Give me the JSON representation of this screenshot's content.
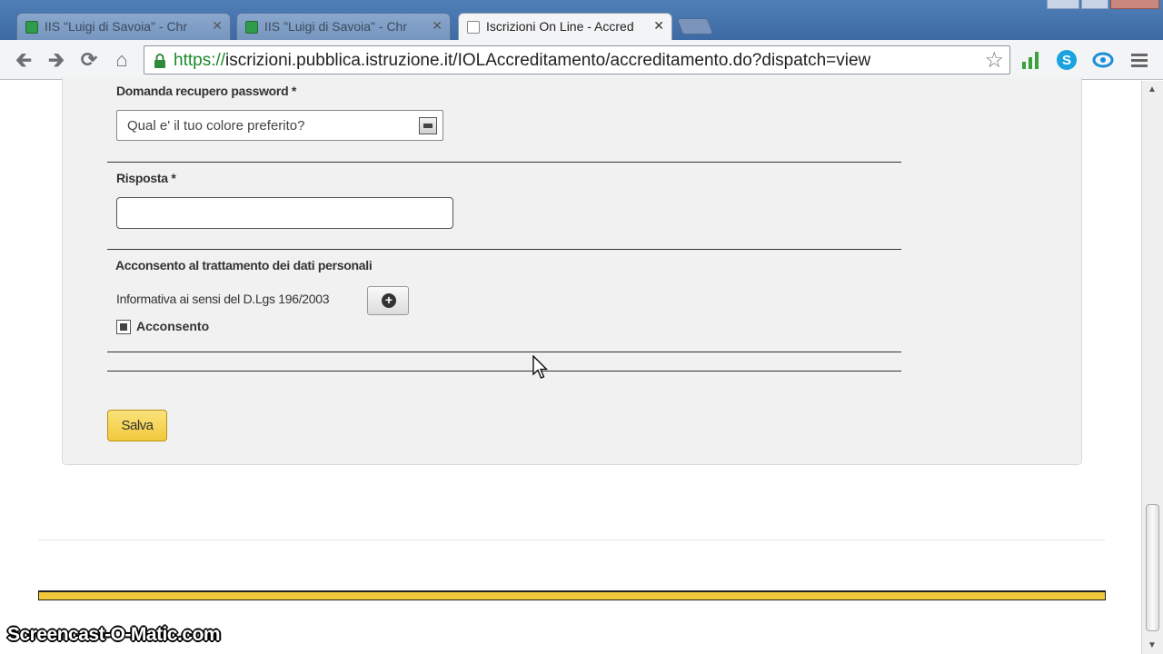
{
  "browser": {
    "tabs": [
      {
        "title": "IIS \"Luigi di Savoia\" - Chr",
        "active": false
      },
      {
        "title": "IIS \"Luigi di Savoia\" - Chr",
        "active": false
      },
      {
        "title": "Iscrizioni On Line - Accred",
        "active": true
      }
    ],
    "close_glyph": "✕",
    "url_scheme": "https://",
    "url_rest": "iscrizioni.pubblica.istruzione.it/IOLAccreditamento/accreditamento.do?dispatch=view",
    "icons": [
      "back-icon",
      "forward-icon",
      "reload-icon",
      "home-icon",
      "lock-icon",
      "star-icon",
      "signal-icon",
      "skype-icon",
      "sync-icon",
      "menu-icon"
    ]
  },
  "form": {
    "security_question_label": "Domanda recupero password *",
    "security_question_value": "Qual e' il tuo colore preferito?",
    "answer_label": "Risposta *",
    "answer_value": "",
    "consent_section_title": "Acconsento al trattamento dei dati personali",
    "informativa_text": "Informativa ai sensi del D.Lgs 196/2003",
    "consent_label": "Acconsento",
    "consent_checked": true,
    "save_label": "Salva"
  },
  "overlay": {
    "watermark": "Screencast-O-Matic.com"
  },
  "colors": {
    "accent_yellow": "#f0c93a",
    "https_green": "#1a8a2a",
    "tabstrip_blue": "#4f7fb8"
  }
}
